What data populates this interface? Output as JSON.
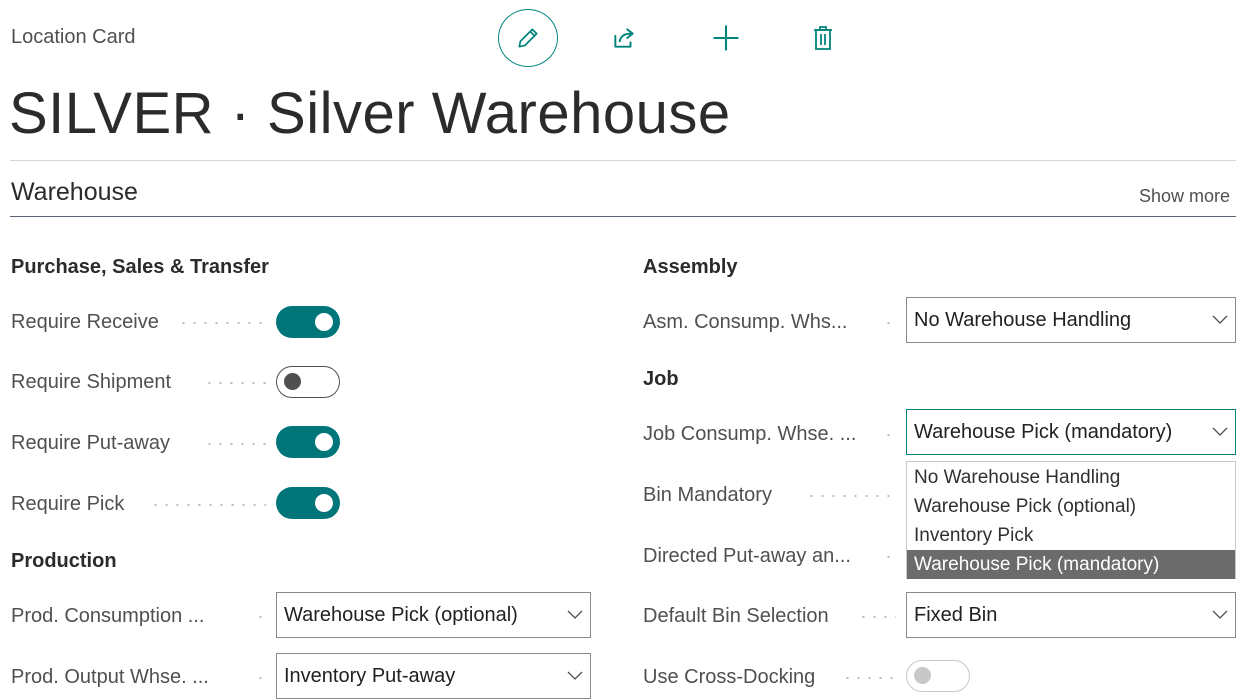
{
  "page": {
    "kind": "Location Card",
    "title": "SILVER · Silver Warehouse"
  },
  "actions": {
    "edit": "pencil-icon",
    "share": "share-icon",
    "new": "plus-icon",
    "delete": "trash-icon"
  },
  "section": {
    "title": "Warehouse",
    "show_more": "Show more"
  },
  "left": {
    "group1": "Purchase, Sales & Transfer",
    "require_receive": {
      "label": "Require Receive",
      "value": true
    },
    "require_shipment": {
      "label": "Require Shipment",
      "value": false
    },
    "require_putaway": {
      "label": "Require Put-away",
      "value": true
    },
    "require_pick": {
      "label": "Require Pick",
      "value": true
    },
    "group2": "Production",
    "prod_consumption": {
      "label": "Prod. Consumption ...",
      "value": "Warehouse Pick (optional)"
    },
    "prod_output": {
      "label": "Prod. Output Whse. ...",
      "value": "Inventory Put-away"
    }
  },
  "right": {
    "group1": "Assembly",
    "asm_consump": {
      "label": "Asm. Consump. Whs...",
      "value": "No Warehouse Handling"
    },
    "group2": "Job",
    "job_consump": {
      "label": "Job Consump. Whse. ...",
      "value": "Warehouse Pick (mandatory)"
    },
    "bin_mandatory": {
      "label": "Bin Mandatory"
    },
    "directed_putaway": {
      "label": "Directed Put-away an..."
    },
    "default_bin": {
      "label": "Default Bin Selection",
      "value": "Fixed Bin"
    },
    "cross_docking": {
      "label": "Use Cross-Docking",
      "value": false
    }
  },
  "dropdown": {
    "options": [
      "No Warehouse Handling",
      "Warehouse Pick (optional)",
      "Inventory Pick",
      "Warehouse Pick (mandatory)"
    ],
    "selected": "Warehouse Pick (mandatory)"
  },
  "colors": {
    "accent": "#00757a",
    "selected_option": "#6b6b6b"
  }
}
